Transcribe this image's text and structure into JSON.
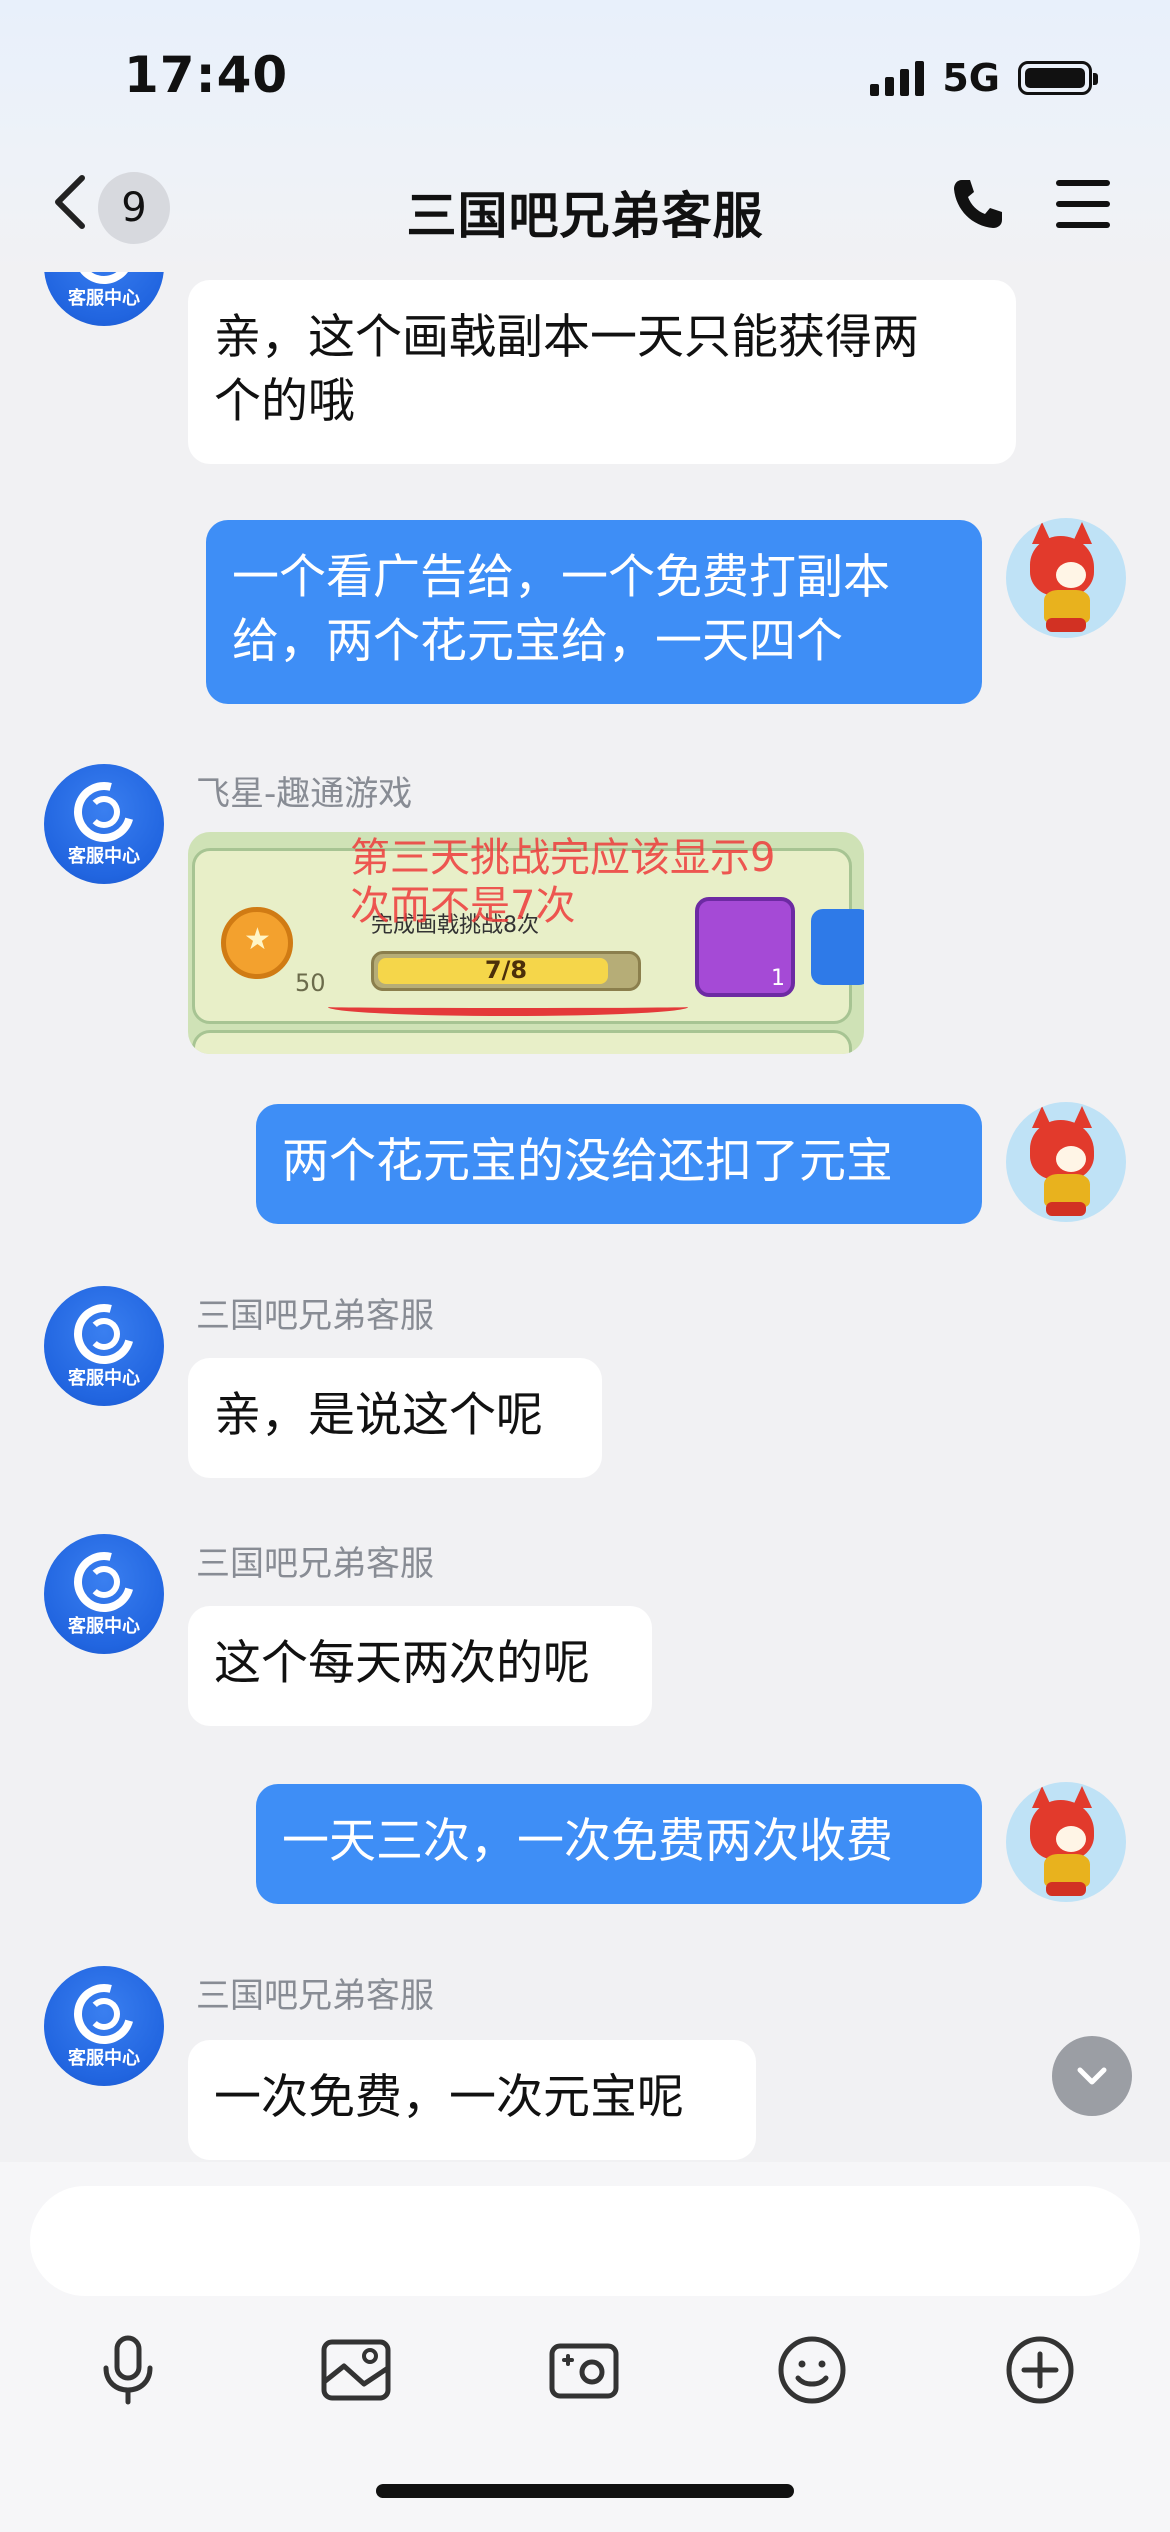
{
  "status_bar": {
    "time": "17:40",
    "network": "5G"
  },
  "header": {
    "back_count": "9",
    "title": "三国吧兄弟客服"
  },
  "messages": [
    {
      "side": "in",
      "text_line1": "亲，这个画戟副本一天只能获得两",
      "text_line2": "个的哦"
    },
    {
      "side": "out",
      "text_line1": "一个看广告给，一个免费打副本",
      "text_line2": "给，两个花元宝给，一天四个"
    },
    {
      "side": "in",
      "sender": "飞星-趣通游戏",
      "image": {
        "overlay_text_line1": "第三天挑战完应该显示9",
        "overlay_text_line2": "次而不是7次",
        "task_text": "完成画戟挑战8次",
        "progress": "7/8",
        "medal_value": "50",
        "item_count": "1"
      }
    },
    {
      "side": "out",
      "text": "两个花元宝的没给还扣了元宝"
    },
    {
      "side": "in",
      "sender": "三国吧兄弟客服",
      "text": "亲，是说这个呢"
    },
    {
      "side": "in",
      "sender": "三国吧兄弟客服",
      "text": "这个每天两次的呢"
    },
    {
      "side": "out",
      "text": "一天三次，一次免费两次收费"
    },
    {
      "side": "in",
      "sender": "三国吧兄弟客服",
      "text": "一次免费，一次元宝呢"
    }
  ],
  "avatar": {
    "cs_label": "客服中心"
  },
  "composer": {
    "placeholder": ""
  },
  "toolbar": [
    "microphone-icon",
    "image-icon",
    "camera-icon",
    "emoji-icon",
    "plus-icon"
  ],
  "colors": {
    "out_bubble": "#3e8ef6",
    "in_bubble": "#ffffff",
    "background": "#f1f1f3"
  }
}
